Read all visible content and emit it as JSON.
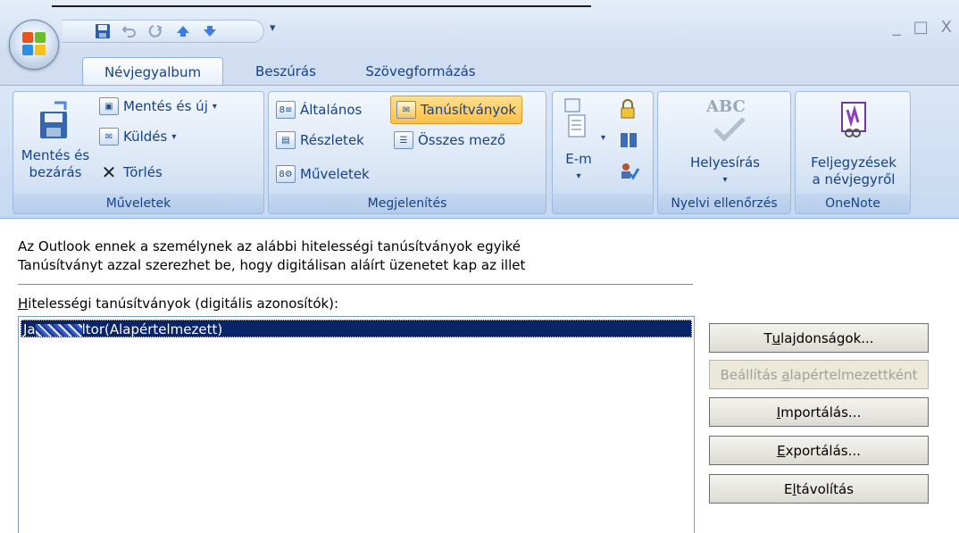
{
  "ribbon_tabs": {
    "active": "Névjegyalbum",
    "insert": "Beszúrás",
    "format": "Szövegformázás"
  },
  "window": {
    "minimize": "_",
    "maximize": "□",
    "close": "X"
  },
  "qat": {
    "save_icon": "save-icon",
    "undo_icon": "undo-icon",
    "redo_icon": "redo-icon",
    "up_icon": "arrow-up-icon",
    "down_icon": "arrow-down-icon",
    "dropdown": "▾"
  },
  "help": "?",
  "groups": {
    "muveletek": {
      "label": "Műveletek",
      "save_close_line1": "Mentés és",
      "save_close_line2": "bezárás",
      "save_new": "Mentés és új",
      "send": "Küldés",
      "delete": "Törlés"
    },
    "megjelenites": {
      "label": "Megjelenítés",
      "general": "Általános",
      "certificates": "Tanúsítványok",
      "details": "Részletek",
      "all_fields": "Összes mező",
      "activities": "Műveletek"
    },
    "options": {
      "email_label": "E-m"
    },
    "proofing": {
      "label": "Nyelvi ellenőrzés",
      "abc": "ABC",
      "spelling": "Helyesírás"
    },
    "onenote": {
      "label": "OneNote",
      "line1": "Feljegyzések",
      "line2": "a névjegyről"
    }
  },
  "content": {
    "info_line1": "Az Outlook ennek a személynek az alábbi hitelességi tanúsítványok egyiké",
    "info_line2": "Tanúsítványt azzal szerezhet be, hogy digitálisan aláírt üzenetet kap az illet",
    "list_label_access": "H",
    "list_label_rest": "itelességi tanúsítványok (digitális azonosítók):",
    "cert_prefix": "Ja",
    "cert_suffix": "ltor(Alapértelmezett)"
  },
  "buttons": {
    "properties_pre": "T",
    "properties_key": "u",
    "properties_post": "lajdonságok...",
    "set_default_pre": "Beállítás ",
    "set_default_key": "a",
    "set_default_post": "lapértelmezettként",
    "import_pre": "",
    "import_key": "I",
    "import_post": "mportálás...",
    "export_pre": "",
    "export_key": "E",
    "export_post": "xportálás...",
    "remove_pre": "E",
    "remove_key": "l",
    "remove_post": "távolítás"
  }
}
